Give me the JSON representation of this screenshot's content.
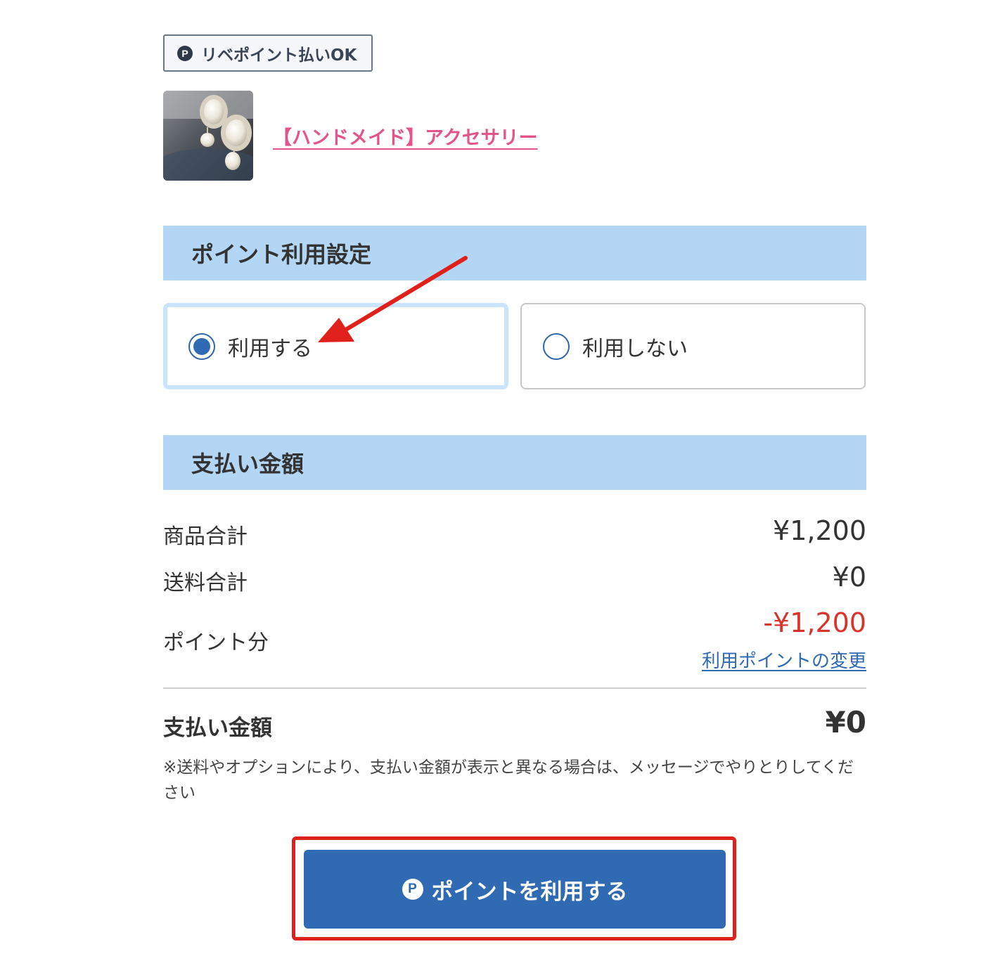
{
  "badge": {
    "icon": "p-icon",
    "icon_text": "P",
    "label": "リベポイント払いOK"
  },
  "product": {
    "image": "earrings-thumbnail",
    "title": "【ハンドメイド】アクセサリー"
  },
  "point_settings": {
    "heading": "ポイント利用設定",
    "options": [
      {
        "label": "利用する",
        "selected": true
      },
      {
        "label": "利用しない",
        "selected": false
      }
    ]
  },
  "payment": {
    "heading": "支払い金額",
    "rows": [
      {
        "label": "商品合計",
        "value": "¥1,200"
      },
      {
        "label": "送料合計",
        "value": "¥0"
      },
      {
        "label": "ポイント分",
        "value": "-¥1,200"
      }
    ],
    "change_link": "利用ポイントの変更",
    "total_label": "支払い金額",
    "total_value": "¥0",
    "note": "※送料やオプションにより、支払い金額が表示と異なる場合は、メッセージでやりとりしてください"
  },
  "cta": {
    "icon_text": "P",
    "label": "ポイントを利用する"
  },
  "colors": {
    "accent_blue": "#2f6ab3",
    "section_bg": "#b3d6f5",
    "link_pink": "#e2548a",
    "negative_red": "#d9342b",
    "annotation_red": "#e0201a"
  }
}
